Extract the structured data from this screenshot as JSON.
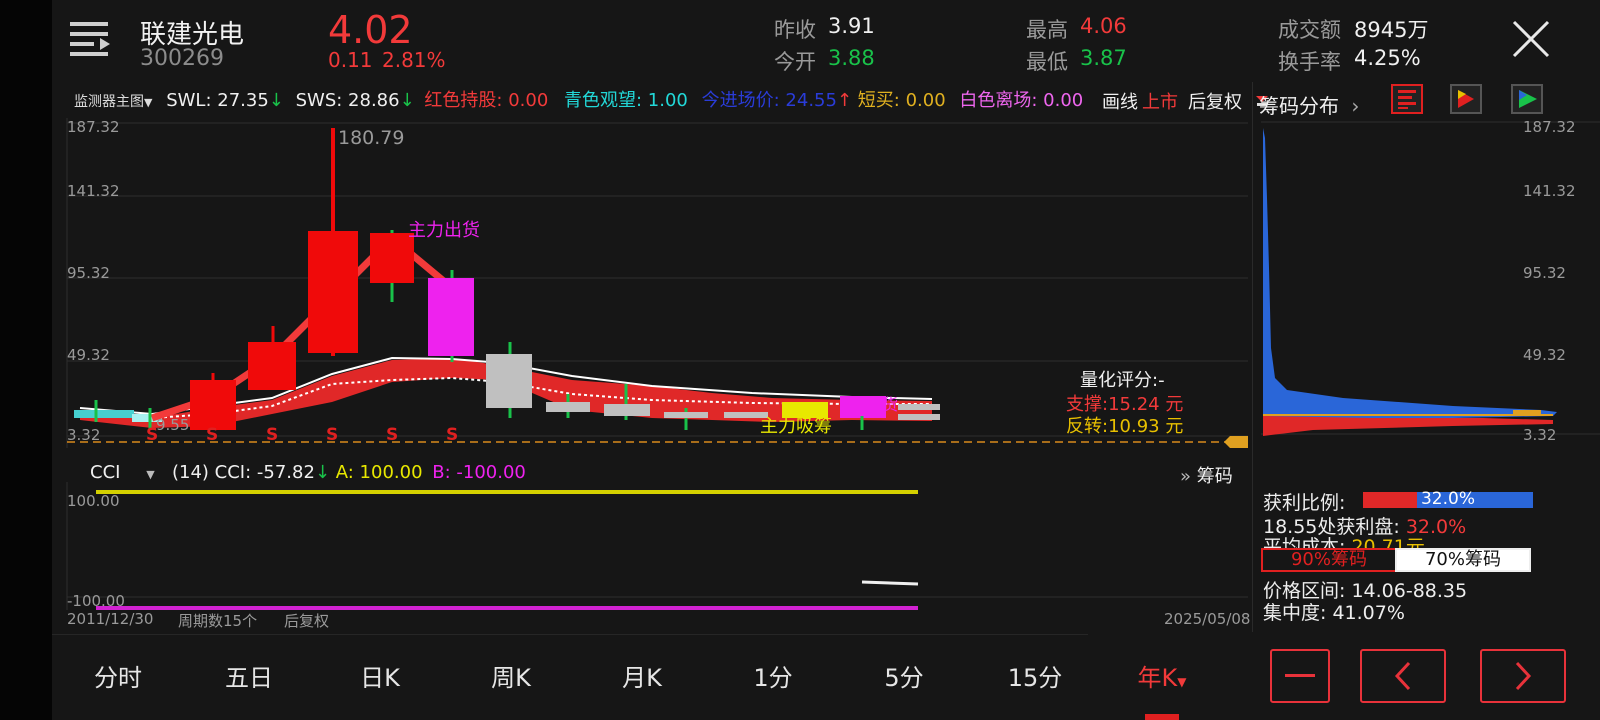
{
  "stock": {
    "name": "联建光电",
    "code": "300269",
    "price": "4.02",
    "change": "0.11",
    "change_pct": "2.81%"
  },
  "quote": {
    "prev_close_label": "昨收",
    "prev_close": "3.91",
    "open_label": "今开",
    "open": "3.88",
    "high_label": "最高",
    "high": "4.06",
    "low_label": "最低",
    "low": "3.87",
    "turnover_label": "成交额",
    "turnover": "8945万",
    "turnover_rate_label": "换手率",
    "turnover_rate": "4.25%"
  },
  "indicators": {
    "monitor_label": "监测器主图",
    "swl": "SWL: 27.35",
    "sws": "SWS: 28.86",
    "red_hold": "红色持股: 0.00",
    "cyan_watch": "青色观望: 1.00",
    "entry_price": "今进场价: 24.55",
    "short_buy": "短买: 0.00",
    "white_exit": "白色离场: 0.00",
    "ma_line": "画线",
    "listing": "上市",
    "adjust": "后复权"
  },
  "chip_panel": {
    "title": "筹码分布",
    "axis": [
      "187.32",
      "141.32",
      "95.32",
      "49.32",
      "3.32"
    ],
    "profit_ratio_label": "获利比例:",
    "profit_ratio": "32.0%",
    "profit_at_label": "18.55处获利盘:",
    "profit_at_value": "32.0%",
    "avg_cost_label": "平均成本:",
    "avg_cost": "20.71元",
    "tab_90": "90%筹码",
    "tab_70": "70%筹码",
    "price_range": "价格区间: 14.06-88.35",
    "concentration": "集中度: 41.07%",
    "profit_bar_fraction": 0.32
  },
  "main_chart": {
    "axis": [
      "187.32",
      "141.32",
      "95.32",
      "49.32",
      "3.32"
    ],
    "high_label": "180.79",
    "low_label": "9.55",
    "ann_sell": "主力出货",
    "ann_buy": "主力吸筹",
    "ann_small": "货",
    "score_label": "量化评分:-",
    "support": "支撑:15.24 元",
    "reversal": "反转:10.93 元",
    "s_marker": "S"
  },
  "cci": {
    "name": "CCI",
    "params": "(14) CCI: -57.82",
    "a": "A: 100.00",
    "b": "B: -100.00",
    "chips_link": "筹码",
    "axis_top": "100.00",
    "axis_bottom": "-100.00",
    "start_date": "2011/12/30",
    "period_count": "周期数15个",
    "adjust": "后复权",
    "end_date": "2025/05/08"
  },
  "tabs": [
    "分时",
    "五日",
    "日K",
    "周K",
    "月K",
    "1分",
    "5分",
    "15分",
    "年K"
  ],
  "active_tab": "年K",
  "colors": {
    "up": "#f23a3a",
    "down": "#19c24a",
    "magenta": "#ee22ee",
    "yellow": "#e8e800",
    "cyan": "#22d8d8",
    "blue": "#2a66d8"
  }
}
